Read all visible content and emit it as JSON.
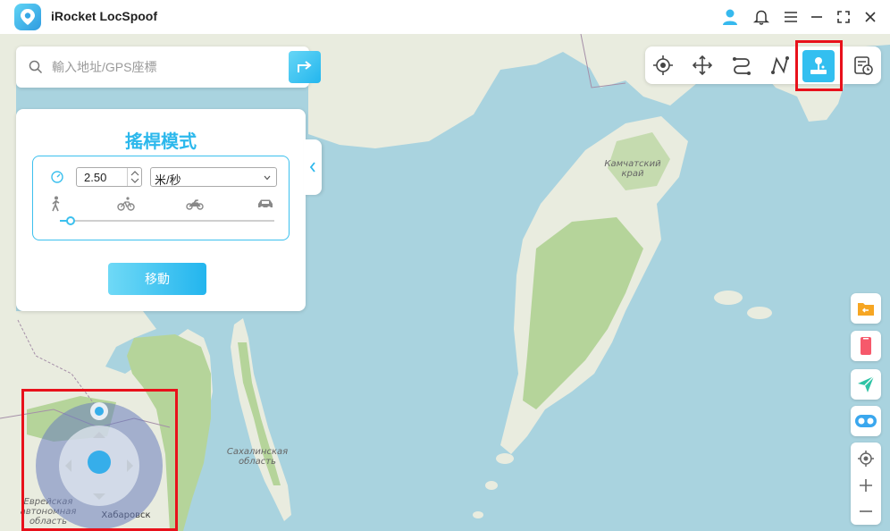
{
  "app": {
    "title": "iRocket LocSpoof"
  },
  "search": {
    "placeholder": "輸入地址/GPS座標"
  },
  "panel": {
    "title": "搖桿模式",
    "speed_value": "2.50",
    "unit": "米/秒",
    "speed_level": 0.05,
    "move_label": "移動"
  },
  "map_labels": {
    "kamchatka": "Камчатский\nкрай",
    "sakhalin": "Сахалинская\nобласть",
    "khabarovsk": "Хабаровск",
    "jewish": "Еврейская\nавтономная\nобласть"
  },
  "toolbar": {
    "tools": [
      "teleport-icon",
      "jump-teleport-icon",
      "two-spot-route-icon",
      "multi-spot-route-icon",
      "joystick-icon",
      "history-icon"
    ],
    "active": "joystick-icon"
  },
  "side": [
    "import-gpx-icon",
    "device-icon",
    "send-icon",
    "toggle-icon",
    "my-location-icon",
    "zoom-in-icon",
    "zoom-out-icon"
  ],
  "colors": {
    "accent": "#2cb8ec",
    "highlight": "#e8111b",
    "sea": "#a9d3df",
    "land": "#e9ecdf",
    "forest": "#b5d49a"
  }
}
